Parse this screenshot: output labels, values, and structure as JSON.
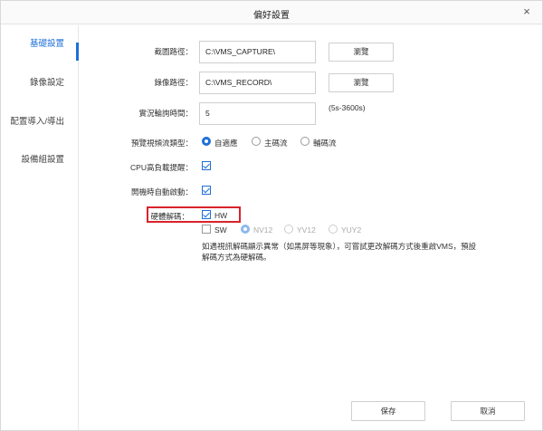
{
  "dialog": {
    "title": "偏好設置",
    "close_glyph": "×"
  },
  "sidebar": {
    "items": [
      {
        "label": "基礎設置",
        "active": true
      },
      {
        "label": "錄像設定",
        "active": false
      },
      {
        "label": "配置導入/導出",
        "active": false
      },
      {
        "label": "設備組設置",
        "active": false
      }
    ]
  },
  "form": {
    "capture_path": {
      "label": "截圖路徑：",
      "value": "C:\\VMS_CAPTURE\\",
      "browse": "瀏覽"
    },
    "record_path": {
      "label": "錄像路徑：",
      "value": "C:\\VMS_RECORD\\",
      "browse": "瀏覽"
    },
    "poll_time": {
      "label": "實況輪詢時間：",
      "value": "5",
      "hint": "(5s-3600s)"
    },
    "stream_type": {
      "label": "預覽視頻流類型：",
      "options": [
        {
          "label": "自適應",
          "checked": true
        },
        {
          "label": "主碼流",
          "checked": false
        },
        {
          "label": "輔碼流",
          "checked": false
        }
      ]
    },
    "cpu_alert": {
      "label": "CPU高負載提醒：",
      "checked": true
    },
    "autostart": {
      "label": "開機時自動啟動：",
      "checked": true
    },
    "hw_decode": {
      "label": "硬體解碼：",
      "hw": {
        "label": "HW",
        "checked": true
      },
      "sw": {
        "label": "SW",
        "checked": false
      },
      "formats": [
        {
          "label": "NV12",
          "checked": true
        },
        {
          "label": "YV12",
          "checked": false
        },
        {
          "label": "YUY2",
          "checked": false
        }
      ],
      "note": "如遇視訊解碼顯示異常（如黑屏等現象），可嘗試更改解碼方式後重啟VMS，預設解碼方式為硬解碼。"
    }
  },
  "footer": {
    "save": "保存",
    "cancel": "取消"
  },
  "colors": {
    "accent": "#1e6fd9",
    "highlight": "#d9232a"
  }
}
